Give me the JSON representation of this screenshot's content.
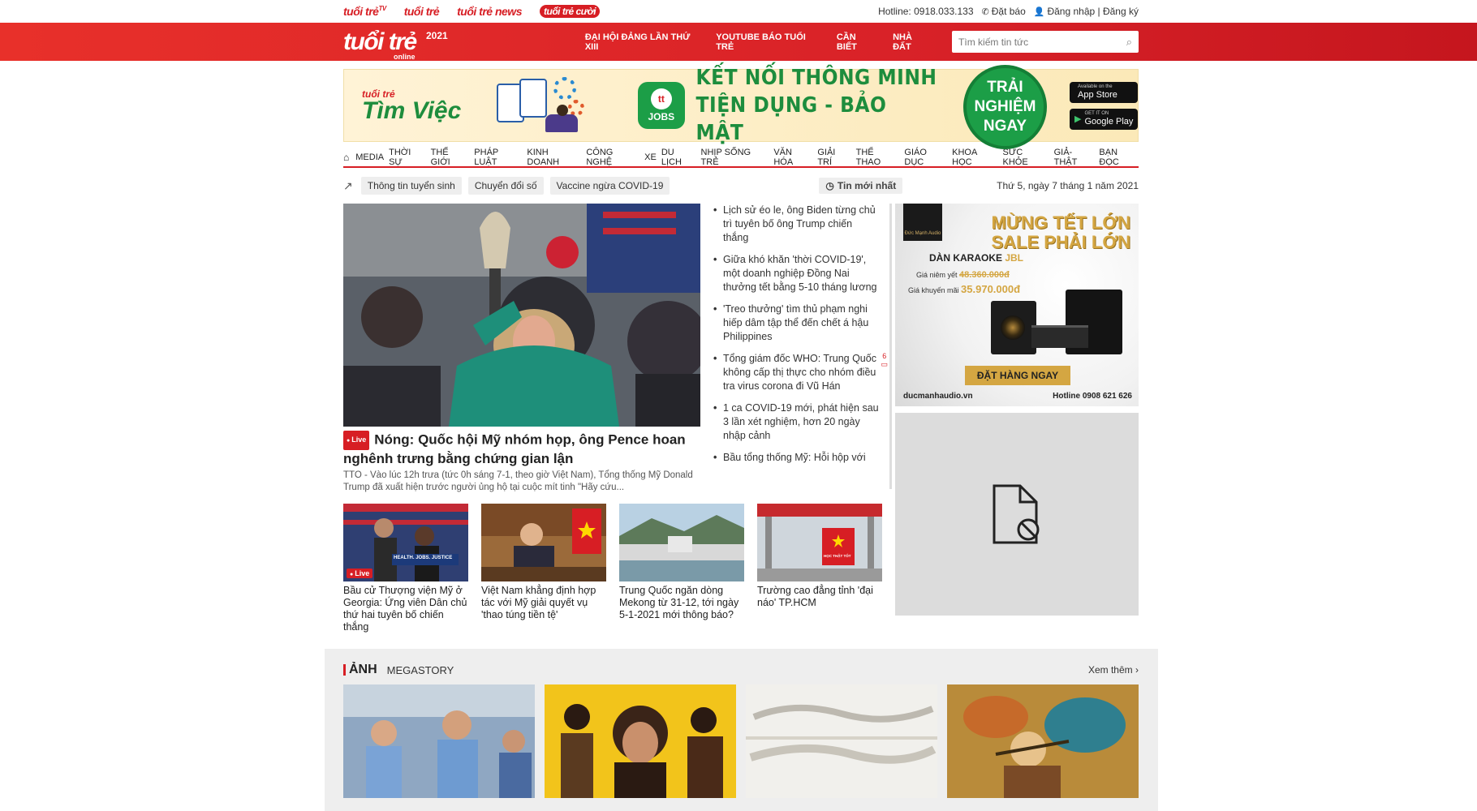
{
  "brands": {
    "tuoitre_tv": "tuổi trẻ",
    "tv_sup": "TV",
    "tuoitre_cuoi": "tuổi trẻ",
    "tuoitre_news": "tuổi trẻ news",
    "cuoi": "tuổi trẻ cười"
  },
  "top_links": {
    "hotline": "Hotline: 0918.033.133",
    "subscribe": "Đặt báo",
    "login": "Đăng nhập | Đăng ký"
  },
  "logo": {
    "text": "tuổi trẻ",
    "year": "2021",
    "online": "online"
  },
  "main_nav": [
    "ĐẠI HỘI ĐẢNG LẦN THỨ XIII",
    "YOUTUBE BÁO TUỔI TRẺ",
    "CẦN BIẾT",
    "NHÀ ĐẤT"
  ],
  "search": {
    "placeholder": "Tìm kiếm tin tức"
  },
  "banner": {
    "brand_small": "tuổi trẻ",
    "brand_big": "Tìm Việc",
    "jobs_badge": "JOBS",
    "slogan_line1": "KẾT NỐI THÔNG MINH",
    "slogan_line2": "TIỆN DỤNG - BẢO MẬT",
    "cta": "TRẢI NGHIỆM NGAY",
    "appstore_small": "Available on the",
    "appstore": "App Store",
    "googleplay_small": "GET IT ON",
    "googleplay": "Google Play"
  },
  "categories": [
    "MEDIA",
    "THỜI SỰ",
    "THẾ GIỚI",
    "PHÁP LUẬT",
    "KINH DOANH",
    "CÔNG NGHỆ",
    "XE",
    "DU LỊCH",
    "NHỊP SỐNG TRẺ",
    "VĂN HÓA",
    "GIẢI TRÍ",
    "THỂ THAO",
    "GIÁO DỤC",
    "KHOA HỌC",
    "SỨC KHỎE",
    "GIẢ-THẬT",
    "BẠN ĐỌC"
  ],
  "tags": [
    "Thông tin tuyển sinh",
    "Chuyển đổi số",
    "Vaccine ngừa COVID-19"
  ],
  "newest_label": "Tin mới nhất",
  "date": "Thứ 5, ngày 7 tháng 1 năm 2021",
  "hero": {
    "live": "Live",
    "title": "Nóng: Quốc hội Mỹ nhóm họp, ông Pence hoan nghênh trưng bằng chứng gian lận",
    "summary": "TTO - Vào lúc 12h trưa (tức 0h sáng 7-1, theo giờ Việt Nam), Tổng thống Mỹ Donald Trump đã xuất hiện trước người ủng hộ tại cuộc mít tinh \"Hãy cứu..."
  },
  "side_news": [
    {
      "title": "Lịch sử éo le, ông Biden từng chủ trì tuyên bố ông Trump chiến thắng"
    },
    {
      "title": "Giữa khó khăn 'thời COVID-19', một doanh nghiệp Đồng Nai thưởng tết bằng 5-10 tháng lương"
    },
    {
      "title": "'Treo thưởng' tìm thủ phạm nghi hiếp dâm tập thể đến chết á hậu Philippines"
    },
    {
      "title": "Tổng giám đốc WHO: Trung Quốc không cấp thị thực cho nhóm điều tra virus corona đi Vũ Hán",
      "comments": "6"
    },
    {
      "title": "1 ca COVID-19 mới, phát hiện sau 3 lần xét nghiệm, hơn 20 ngày nhập cảnh"
    },
    {
      "title": "Bầu tổng thống Mỹ: Hỗi hộp với"
    }
  ],
  "thumbs": [
    {
      "title": "Bầu cử Thượng viện Mỹ ở Georgia: Ứng viên Dân chủ thứ hai tuyên bố chiến thắng",
      "live": "Live",
      "sign": "HEALTH. JOBS. JUSTICE"
    },
    {
      "title": "Việt Nam khẳng định hợp tác với Mỹ giải quyết vụ 'thao túng tiền tệ'"
    },
    {
      "title": "Trung Quốc ngăn dòng Mekong từ 31-12, tới ngày 5-1-2021 mới thông báo?"
    },
    {
      "title": "Trường cao đẳng tỉnh 'đại náo' TP.HCM",
      "sign": "HỌC THẬT TỐT"
    }
  ],
  "ad": {
    "brand": "Đức Mạnh Audio",
    "headline1": "MỪNG TẾT LỚN",
    "headline2": "SALE PHẢI LỚN",
    "product": "DÀN KARAOKE",
    "product_brand": "JBL",
    "listed_label": "Giá niêm yết",
    "listed_price": "48.360.000đ",
    "promo_label": "Giá khuyến mãi",
    "promo_price": "35.970.000đ",
    "order": "ĐẶT HÀNG NGAY",
    "url": "ducmanhaudio.vn",
    "hotline": "Hotline 0908 621 626"
  },
  "photo_section": {
    "title": "ẢNH",
    "sub": "MEGASTORY",
    "more": "Xem thêm"
  },
  "colors": {
    "brand_red": "#d71e24",
    "ad_gold": "#d4a642",
    "jobs_green": "#1c9e47"
  }
}
